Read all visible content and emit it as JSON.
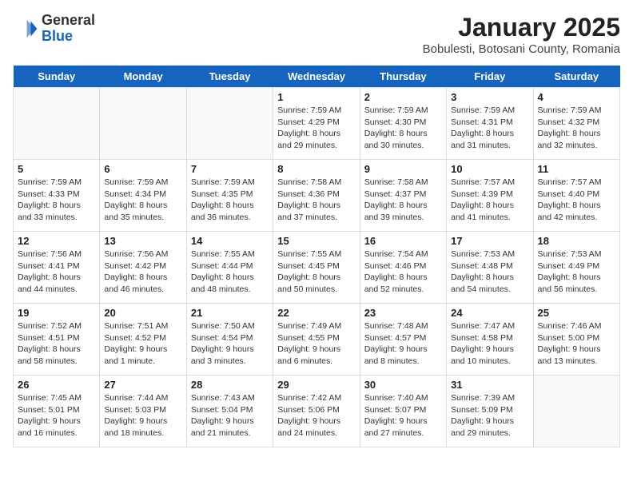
{
  "header": {
    "logo_general": "General",
    "logo_blue": "Blue",
    "main_title": "January 2025",
    "subtitle": "Bobulesti, Botosani County, Romania"
  },
  "days_of_week": [
    "Sunday",
    "Monday",
    "Tuesday",
    "Wednesday",
    "Thursday",
    "Friday",
    "Saturday"
  ],
  "weeks": [
    [
      {
        "day": "",
        "content": ""
      },
      {
        "day": "",
        "content": ""
      },
      {
        "day": "",
        "content": ""
      },
      {
        "day": "1",
        "content": "Sunrise: 7:59 AM\nSunset: 4:29 PM\nDaylight: 8 hours and 29 minutes."
      },
      {
        "day": "2",
        "content": "Sunrise: 7:59 AM\nSunset: 4:30 PM\nDaylight: 8 hours and 30 minutes."
      },
      {
        "day": "3",
        "content": "Sunrise: 7:59 AM\nSunset: 4:31 PM\nDaylight: 8 hours and 31 minutes."
      },
      {
        "day": "4",
        "content": "Sunrise: 7:59 AM\nSunset: 4:32 PM\nDaylight: 8 hours and 32 minutes."
      }
    ],
    [
      {
        "day": "5",
        "content": "Sunrise: 7:59 AM\nSunset: 4:33 PM\nDaylight: 8 hours and 33 minutes."
      },
      {
        "day": "6",
        "content": "Sunrise: 7:59 AM\nSunset: 4:34 PM\nDaylight: 8 hours and 35 minutes."
      },
      {
        "day": "7",
        "content": "Sunrise: 7:59 AM\nSunset: 4:35 PM\nDaylight: 8 hours and 36 minutes."
      },
      {
        "day": "8",
        "content": "Sunrise: 7:58 AM\nSunset: 4:36 PM\nDaylight: 8 hours and 37 minutes."
      },
      {
        "day": "9",
        "content": "Sunrise: 7:58 AM\nSunset: 4:37 PM\nDaylight: 8 hours and 39 minutes."
      },
      {
        "day": "10",
        "content": "Sunrise: 7:57 AM\nSunset: 4:39 PM\nDaylight: 8 hours and 41 minutes."
      },
      {
        "day": "11",
        "content": "Sunrise: 7:57 AM\nSunset: 4:40 PM\nDaylight: 8 hours and 42 minutes."
      }
    ],
    [
      {
        "day": "12",
        "content": "Sunrise: 7:56 AM\nSunset: 4:41 PM\nDaylight: 8 hours and 44 minutes."
      },
      {
        "day": "13",
        "content": "Sunrise: 7:56 AM\nSunset: 4:42 PM\nDaylight: 8 hours and 46 minutes."
      },
      {
        "day": "14",
        "content": "Sunrise: 7:55 AM\nSunset: 4:44 PM\nDaylight: 8 hours and 48 minutes."
      },
      {
        "day": "15",
        "content": "Sunrise: 7:55 AM\nSunset: 4:45 PM\nDaylight: 8 hours and 50 minutes."
      },
      {
        "day": "16",
        "content": "Sunrise: 7:54 AM\nSunset: 4:46 PM\nDaylight: 8 hours and 52 minutes."
      },
      {
        "day": "17",
        "content": "Sunrise: 7:53 AM\nSunset: 4:48 PM\nDaylight: 8 hours and 54 minutes."
      },
      {
        "day": "18",
        "content": "Sunrise: 7:53 AM\nSunset: 4:49 PM\nDaylight: 8 hours and 56 minutes."
      }
    ],
    [
      {
        "day": "19",
        "content": "Sunrise: 7:52 AM\nSunset: 4:51 PM\nDaylight: 8 hours and 58 minutes."
      },
      {
        "day": "20",
        "content": "Sunrise: 7:51 AM\nSunset: 4:52 PM\nDaylight: 9 hours and 1 minute."
      },
      {
        "day": "21",
        "content": "Sunrise: 7:50 AM\nSunset: 4:54 PM\nDaylight: 9 hours and 3 minutes."
      },
      {
        "day": "22",
        "content": "Sunrise: 7:49 AM\nSunset: 4:55 PM\nDaylight: 9 hours and 6 minutes."
      },
      {
        "day": "23",
        "content": "Sunrise: 7:48 AM\nSunset: 4:57 PM\nDaylight: 9 hours and 8 minutes."
      },
      {
        "day": "24",
        "content": "Sunrise: 7:47 AM\nSunset: 4:58 PM\nDaylight: 9 hours and 10 minutes."
      },
      {
        "day": "25",
        "content": "Sunrise: 7:46 AM\nSunset: 5:00 PM\nDaylight: 9 hours and 13 minutes."
      }
    ],
    [
      {
        "day": "26",
        "content": "Sunrise: 7:45 AM\nSunset: 5:01 PM\nDaylight: 9 hours and 16 minutes."
      },
      {
        "day": "27",
        "content": "Sunrise: 7:44 AM\nSunset: 5:03 PM\nDaylight: 9 hours and 18 minutes."
      },
      {
        "day": "28",
        "content": "Sunrise: 7:43 AM\nSunset: 5:04 PM\nDaylight: 9 hours and 21 minutes."
      },
      {
        "day": "29",
        "content": "Sunrise: 7:42 AM\nSunset: 5:06 PM\nDaylight: 9 hours and 24 minutes."
      },
      {
        "day": "30",
        "content": "Sunrise: 7:40 AM\nSunset: 5:07 PM\nDaylight: 9 hours and 27 minutes."
      },
      {
        "day": "31",
        "content": "Sunrise: 7:39 AM\nSunset: 5:09 PM\nDaylight: 9 hours and 29 minutes."
      },
      {
        "day": "",
        "content": ""
      }
    ]
  ]
}
